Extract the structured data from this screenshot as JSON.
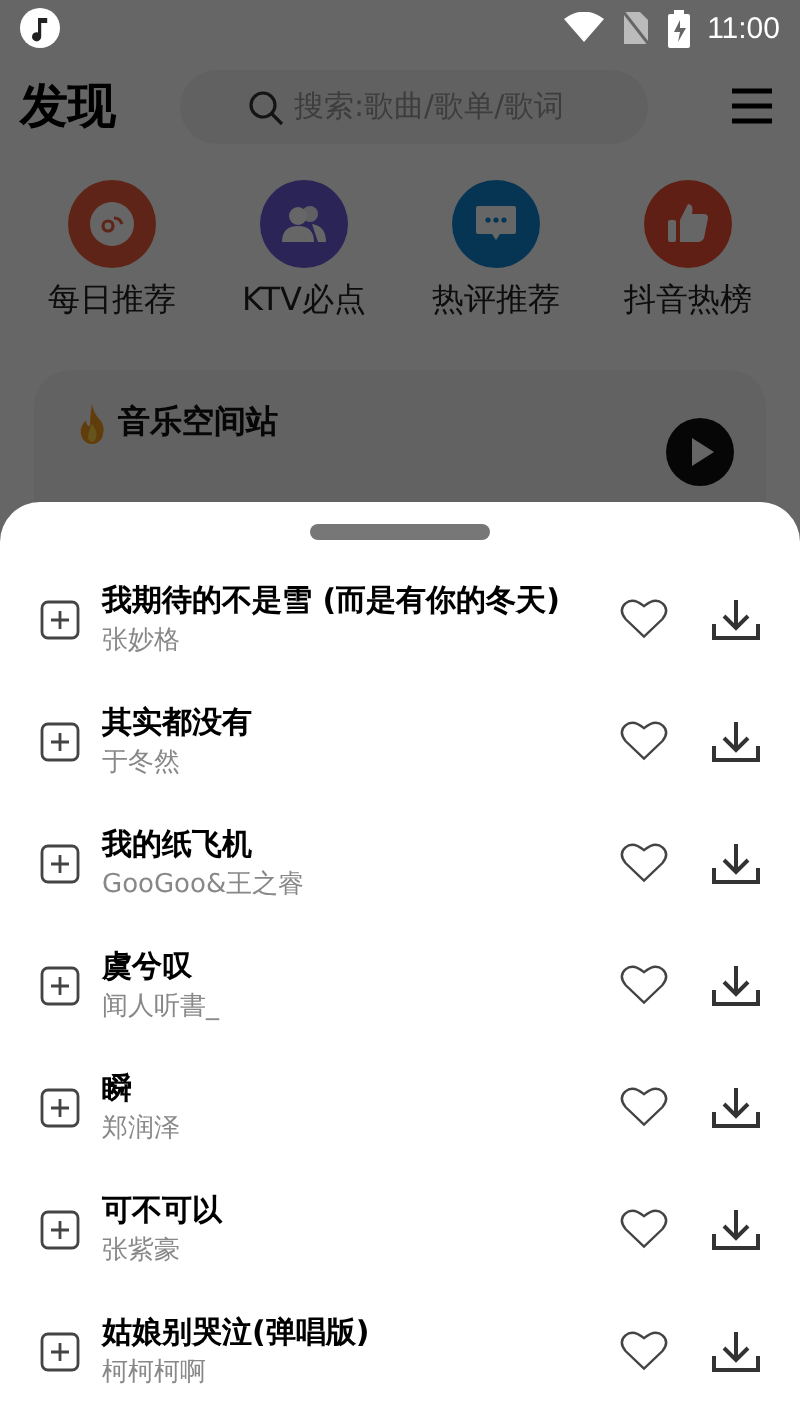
{
  "status_bar": {
    "time": "11:00"
  },
  "header": {
    "title": "发现",
    "search": {
      "placeholder": "搜索:歌曲/歌单/歌词"
    }
  },
  "categories": [
    {
      "label": "每日推荐",
      "kind": "disc"
    },
    {
      "label": "KTV必点",
      "kind": "people"
    },
    {
      "label": "热评推荐",
      "kind": "chat"
    },
    {
      "label": "抖音热榜",
      "kind": "thumb"
    }
  ],
  "featured": {
    "title": "音乐空间站"
  },
  "song_sheet": {
    "songs": [
      {
        "title": "我期待的不是雪 (而是有你的冬天)",
        "artist": "张妙格"
      },
      {
        "title": "其实都没有",
        "artist": "于冬然"
      },
      {
        "title": "我的纸飞机",
        "artist": "GooGoo&王之睿"
      },
      {
        "title": "虞兮叹",
        "artist": "闻人听書_"
      },
      {
        "title": "瞬",
        "artist": "郑润泽"
      },
      {
        "title": "可不可以",
        "artist": "张紫豪"
      },
      {
        "title": "姑娘别哭泣(弹唱版)",
        "artist": "柯柯柯啊"
      }
    ]
  }
}
